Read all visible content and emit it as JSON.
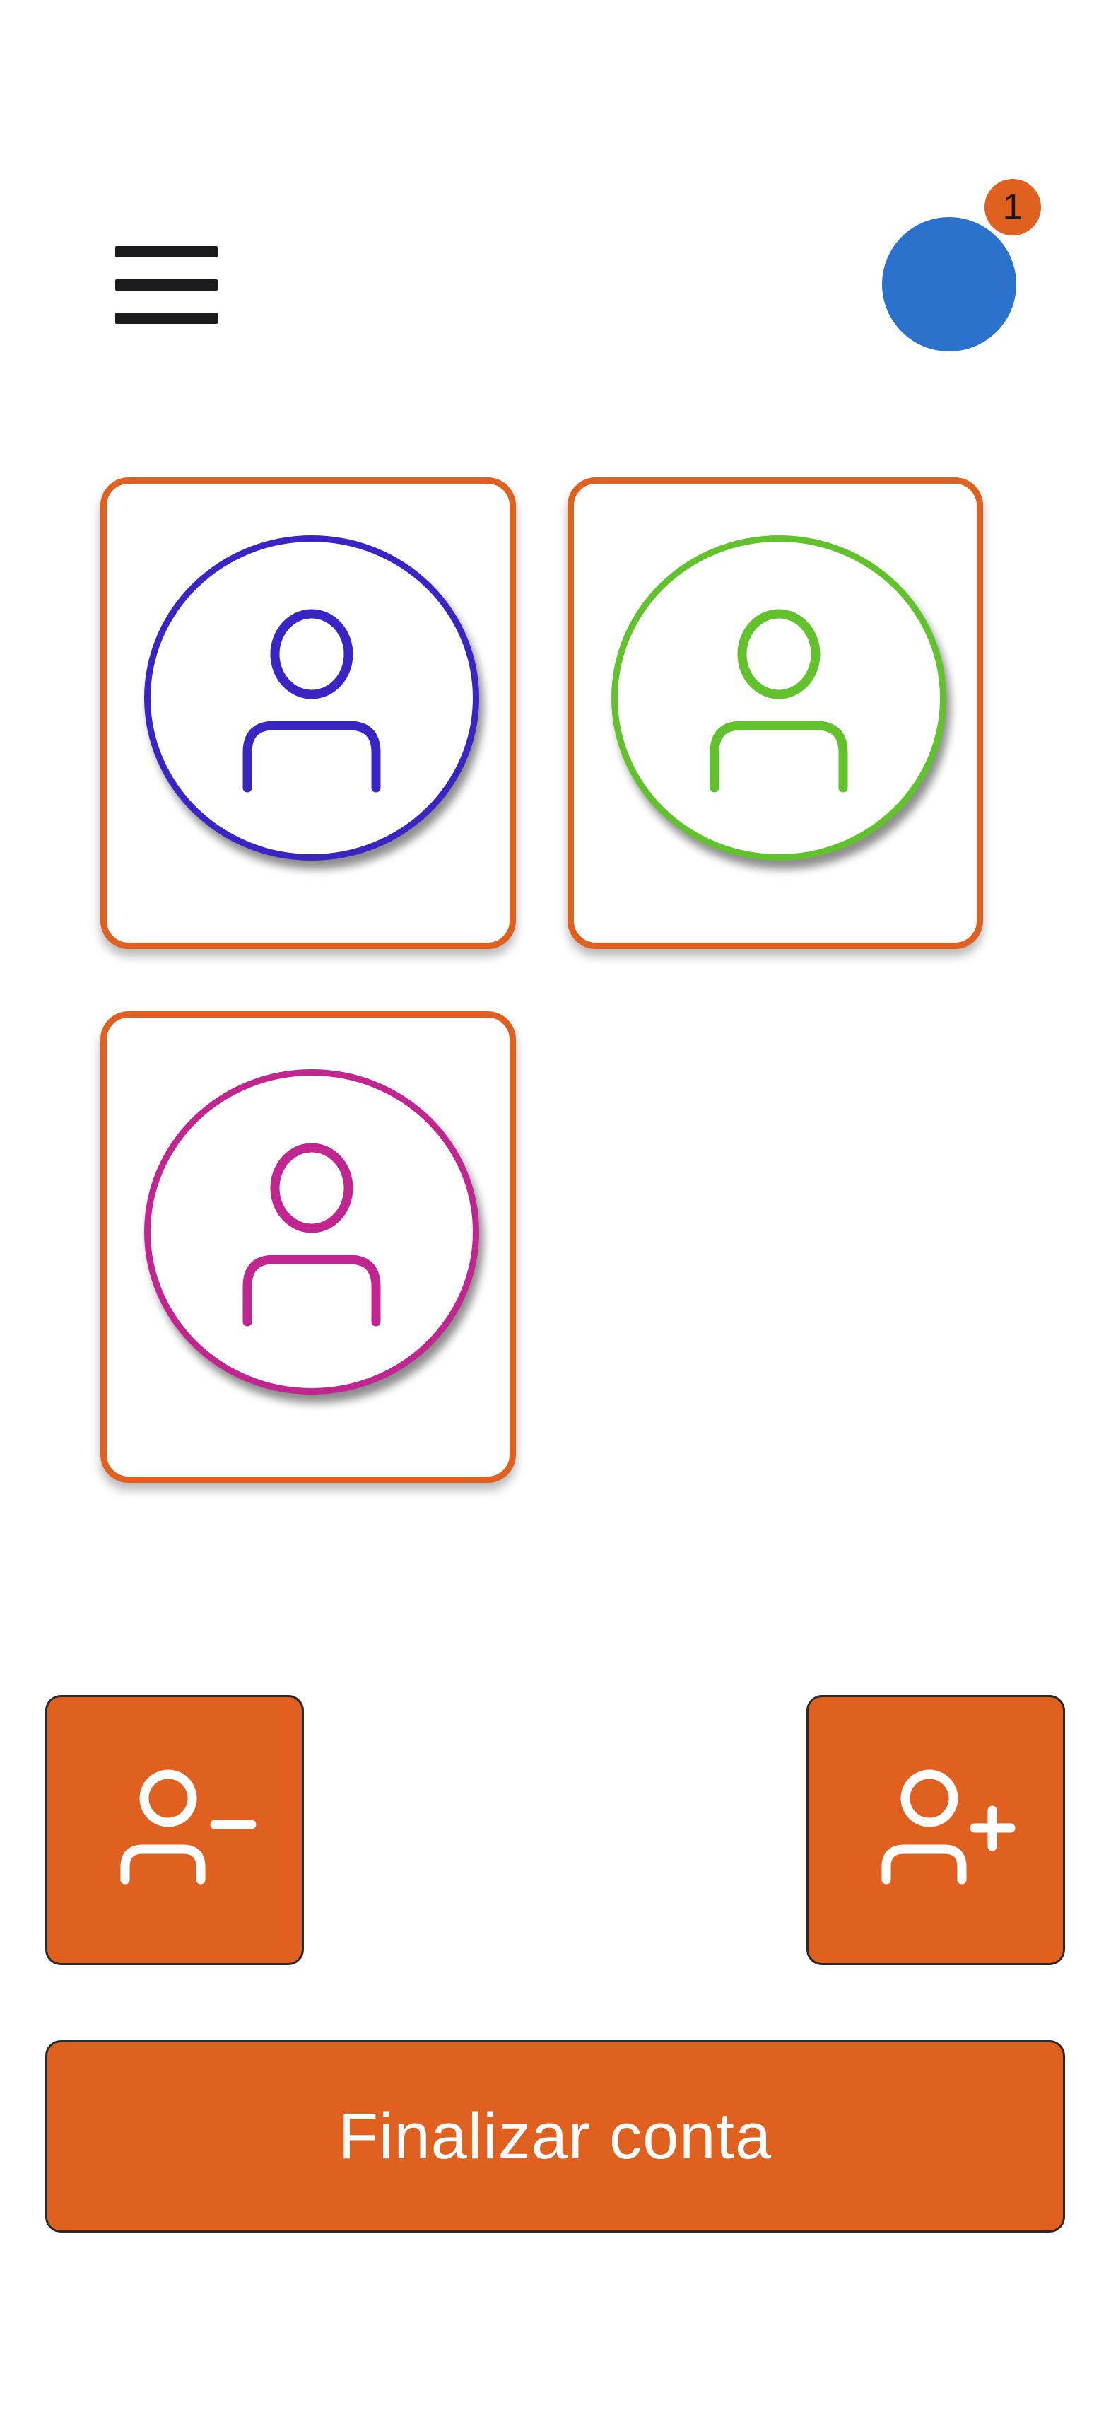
{
  "header": {
    "menu_icon": "hamburger-menu-icon",
    "avatar_color": "#2b72cc",
    "notification_count": "1",
    "badge_color": "#e0601f"
  },
  "profiles": [
    {
      "icon": "user-icon",
      "color": "#3a25c4"
    },
    {
      "icon": "user-icon",
      "color": "#62c22c"
    },
    {
      "icon": "user-icon",
      "color": "#c12690"
    }
  ],
  "actions": {
    "remove_user_icon": "remove-user-icon",
    "add_user_icon": "add-user-icon",
    "finalize_label": "Finalizar conta"
  },
  "colors": {
    "accent": "#e0601f",
    "background": "#ffffff"
  }
}
